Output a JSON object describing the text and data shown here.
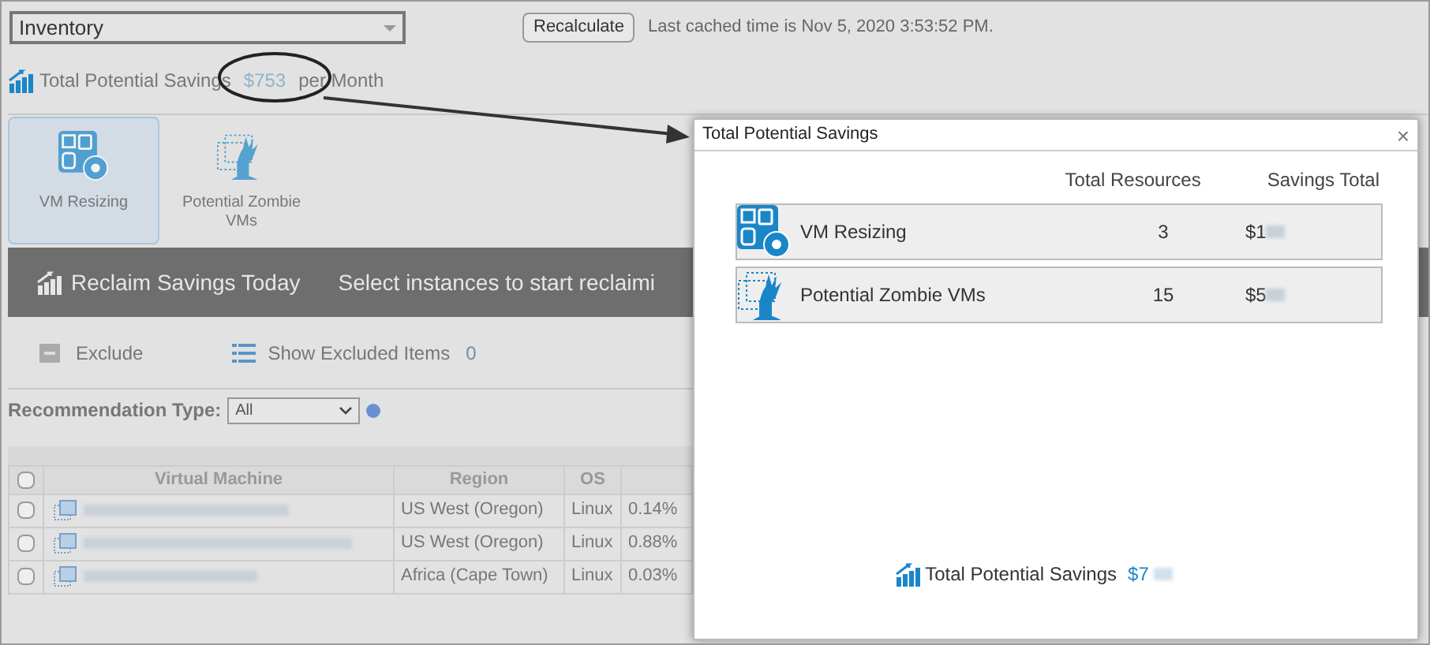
{
  "dropdown": {
    "value": "Inventory"
  },
  "recalculate_button": "Recalculate",
  "cache_note": "Last cached time is Nov 5, 2020 3:53:52 PM.",
  "savings_summary": {
    "label": "Total Potential Savings",
    "amount": "$753",
    "suffix": "per Month"
  },
  "categories": [
    {
      "label": "VM Resizing",
      "selected": true,
      "kind": "resize"
    },
    {
      "label": "Potential Zombie VMs",
      "selected": false,
      "kind": "zombie"
    }
  ],
  "banner": {
    "title": "Reclaim Savings Today",
    "message": "Select instances to start reclaimi"
  },
  "toolbar": {
    "exclude": "Exclude",
    "show_excluded": "Show Excluded Items",
    "excluded_count": "0"
  },
  "filter": {
    "label": "Recommendation Type:",
    "value": "All"
  },
  "table": {
    "select_all_checked": false,
    "columns": [
      "Virtual Machine",
      "Region",
      "OS"
    ],
    "rows": [
      {
        "checked": false,
        "region": "US West (Oregon)",
        "os": "Linux",
        "column_4": "0.14%"
      },
      {
        "checked": false,
        "region": "US West (Oregon)",
        "os": "Linux",
        "column_4": "0.88%"
      },
      {
        "checked": false,
        "region": "Africa (Cape Town)",
        "os": "Linux",
        "column_4": "0.03%"
      }
    ]
  },
  "modal": {
    "title": "Total Potential Savings",
    "close": "×",
    "columns": [
      "Total Resources",
      "Savings Total"
    ],
    "rows": [
      {
        "kind": "resize",
        "label": "VM Resizing",
        "resources": "3",
        "savings": "$1"
      },
      {
        "kind": "zombie",
        "label": "Potential Zombie VMs",
        "resources": "15",
        "savings": "$5"
      }
    ],
    "footer": {
      "label": "Total Potential Savings",
      "amount": "$7"
    }
  }
}
